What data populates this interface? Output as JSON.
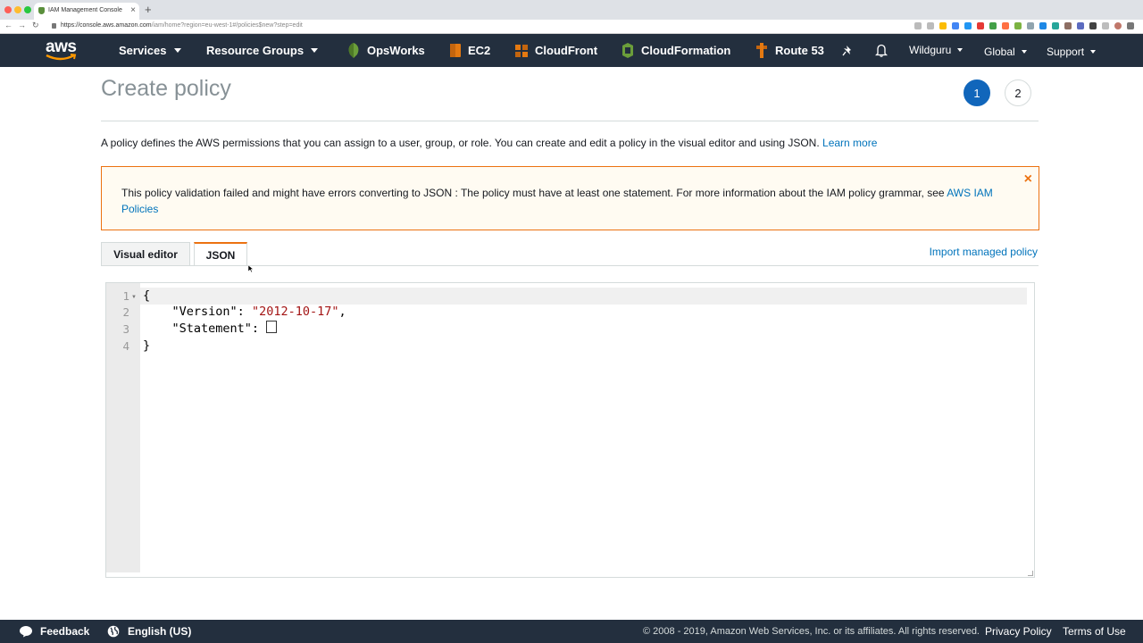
{
  "browser": {
    "tab_title": "IAM Management Console",
    "url_host": "https://console.aws.amazon.com",
    "url_path": "/iam/home?region=eu-west-1#/policies$new?step=edit"
  },
  "nav": {
    "services": "Services",
    "resource_groups": "Resource Groups",
    "opsworks": "OpsWorks",
    "ec2": "EC2",
    "cloudfront": "CloudFront",
    "cloudformation": "CloudFormation",
    "route53": "Route 53",
    "user": "Wildguru",
    "region": "Global",
    "support": "Support"
  },
  "page": {
    "title": "Create policy",
    "step1": "1",
    "step2": "2",
    "description": "A policy defines the AWS permissions that you can assign to a user, group, or role. You can create and edit a policy in the visual editor and using JSON.",
    "learn_more": "Learn more"
  },
  "alert": {
    "message": "This policy validation failed and might have errors converting to JSON : The policy must have at least one statement. For more information about the IAM policy grammar, see",
    "link": "AWS IAM Policies",
    "close": "×"
  },
  "tabs": {
    "visual_editor": "Visual editor",
    "json": "JSON",
    "import_managed_policy": "Import managed policy"
  },
  "editor": {
    "line_numbers": [
      "1",
      "2",
      "3",
      "4"
    ],
    "line1": "{",
    "version_key": "\"Version\"",
    "version_value": "\"2012-10-17\"",
    "statement_key": "\"Statement\"",
    "line4": "}"
  },
  "footer": {
    "feedback": "Feedback",
    "language": "English (US)",
    "copyright": "© 2008 - 2019, Amazon Web Services, Inc. or its affiliates. All rights reserved.",
    "privacy": "Privacy Policy",
    "terms": "Terms of Use"
  },
  "colors": {
    "nav_bg": "#232f3e",
    "link": "#0073bb",
    "accent_orange": "#ec7211",
    "step_active": "#1166bb"
  }
}
